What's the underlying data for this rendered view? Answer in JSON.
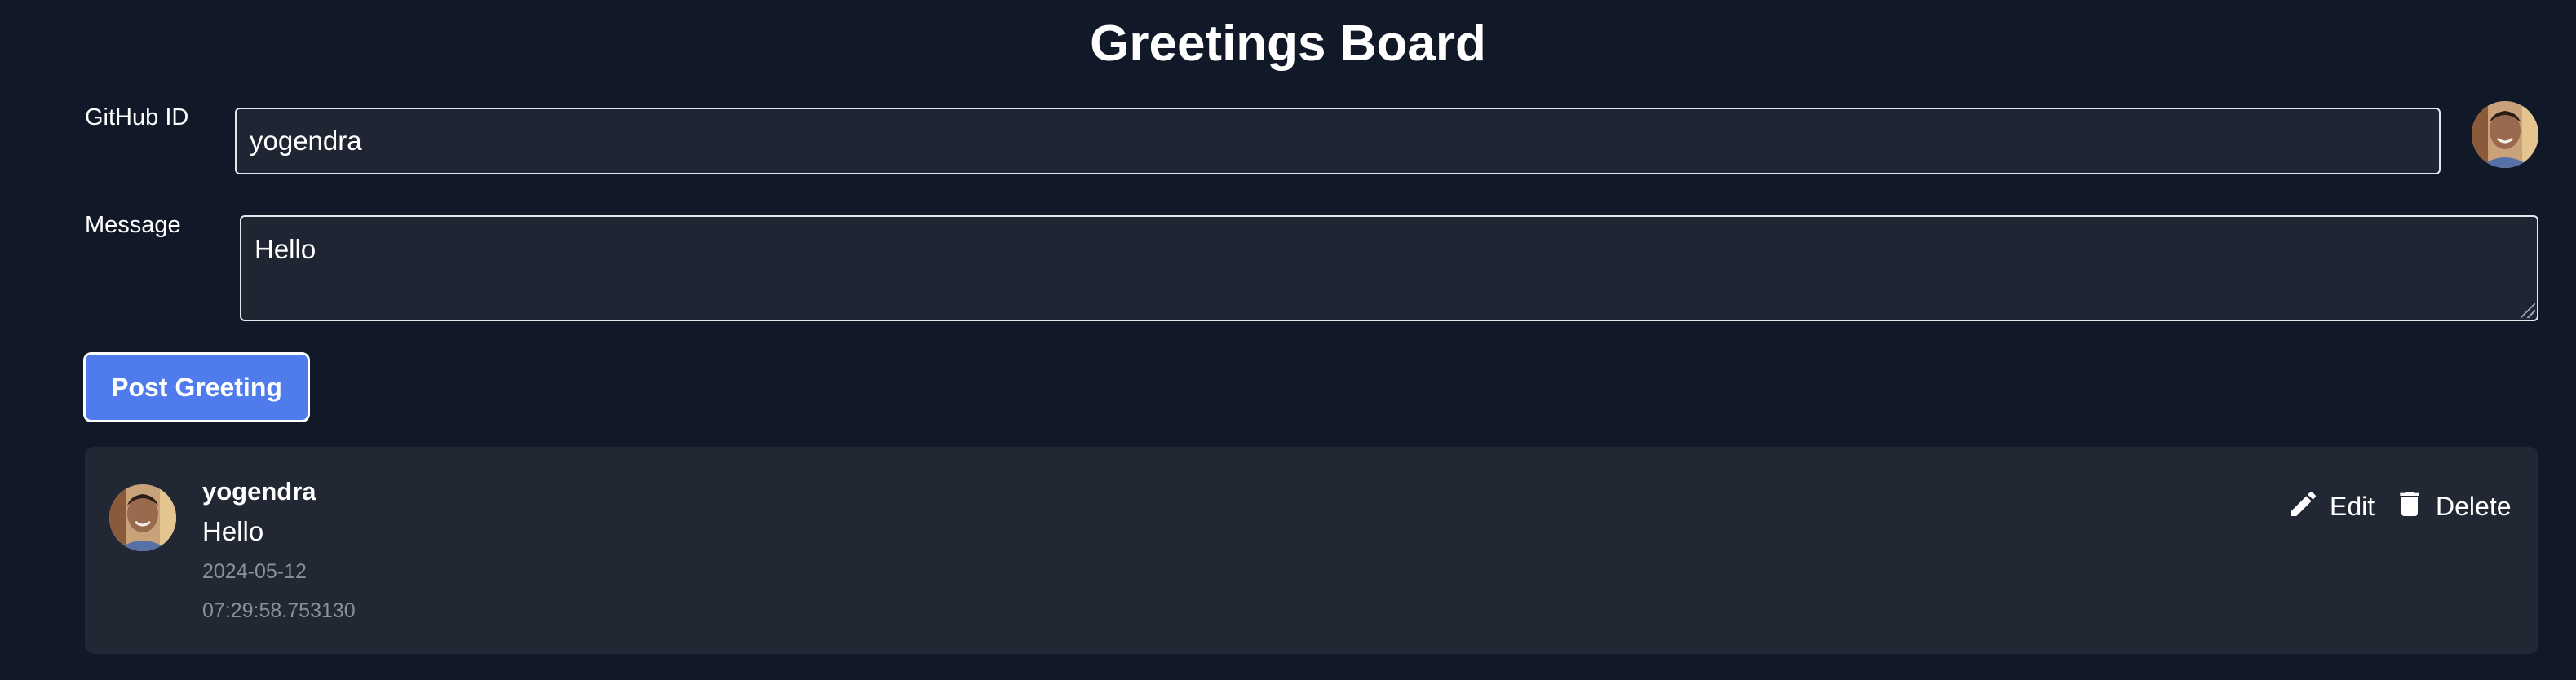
{
  "page": {
    "title": "Greetings Board"
  },
  "form": {
    "github_label": "GitHub ID",
    "github_value": "yogendra",
    "message_label": "Message",
    "message_value": "Hello",
    "submit_label": "Post Greeting"
  },
  "greetings": [
    {
      "author": "yogendra",
      "message": "Hello",
      "date": "2024-05-12",
      "time": "07:29:58.753130",
      "edit_label": "Edit",
      "delete_label": "Delete"
    }
  ],
  "icons": {
    "edit": "pencil-icon",
    "delete": "trash-icon"
  },
  "colors": {
    "background": "#111827",
    "card": "#222734",
    "accent": "#4f7bec"
  }
}
